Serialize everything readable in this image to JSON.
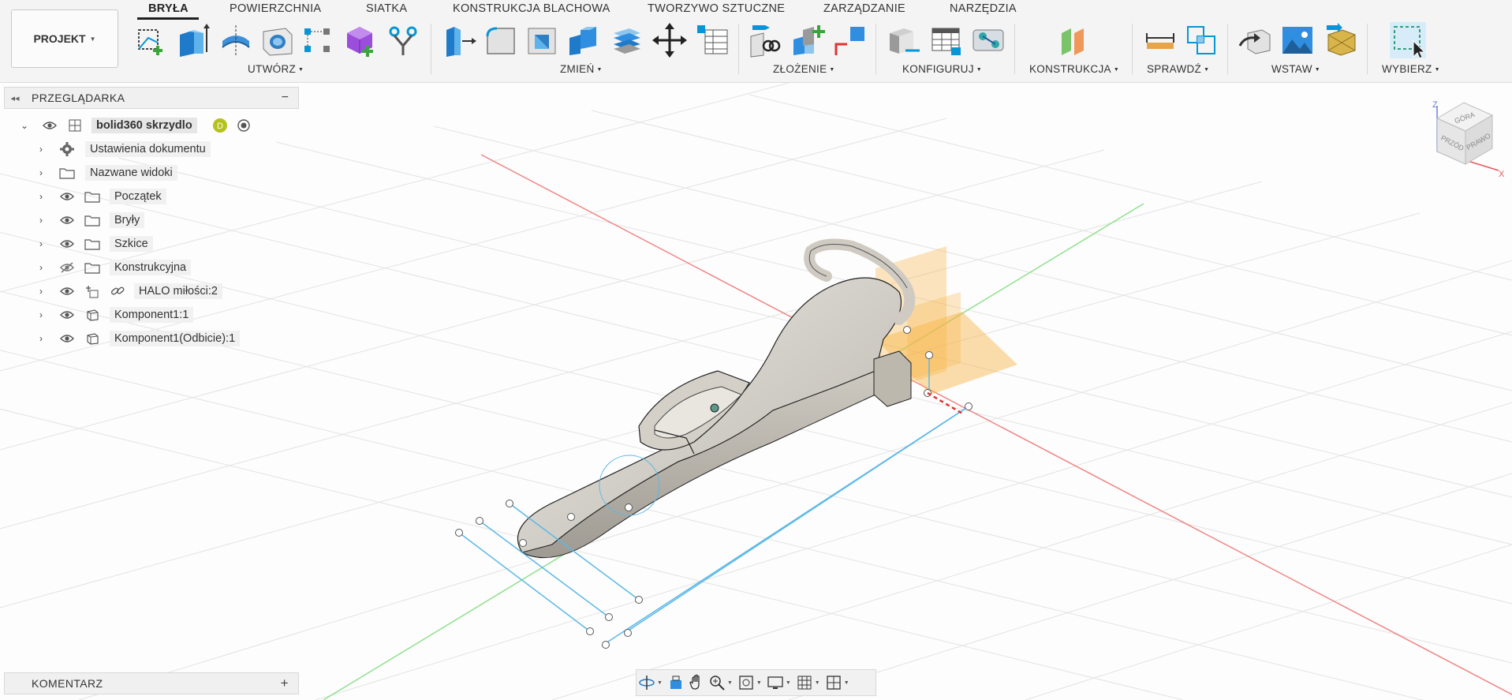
{
  "ribbon": {
    "project_label": "PROJEKT",
    "tabs": [
      "BRYŁA",
      "POWIERZCHNIA",
      "SIATKA",
      "KONSTRUKCJA BLACHOWA",
      "TWORZYWO SZTUCZNE",
      "ZARZĄDZANIE",
      "NARZĘDZIA"
    ],
    "active_tab": "BRYŁA",
    "groups": {
      "create": "UTWÓRZ",
      "modify": "ZMIEŃ",
      "assemble": "ZŁOŻENIE",
      "configure": "KONFIGURUJ",
      "construct": "KONSTRUKCJA",
      "inspect": "SPRAWDŹ",
      "insert": "WSTAW",
      "select": "WYBIERZ"
    }
  },
  "browser": {
    "title": "PRZEGLĄDARKA",
    "root": {
      "label": "bolid360 skrzydlo"
    },
    "items": [
      {
        "label": "Ustawienia dokumentu",
        "icon": "gear-icon"
      },
      {
        "label": "Nazwane widoki",
        "icon": "folder-icon"
      },
      {
        "label": "Początek",
        "icon": "folder-icon"
      },
      {
        "label": "Bryły",
        "icon": "folder-icon"
      },
      {
        "label": "Szkice",
        "icon": "folder-icon"
      },
      {
        "label": "Konstrukcyjna",
        "icon": "folder-icon"
      },
      {
        "label": "HALO miłości:2",
        "icon": "link-icon"
      },
      {
        "label": "Komponent1:1",
        "icon": "component-icon"
      },
      {
        "label": "Komponent1(Odbicie):1",
        "icon": "component-icon"
      }
    ]
  },
  "comments": {
    "title": "KOMENTARZ"
  },
  "viewcube": {
    "top": "GÓRA",
    "front": "PRZÓD",
    "right": "PRAWO",
    "axis_z": "Z",
    "axis_x": "X"
  },
  "colors": {
    "accent": "#0696d7",
    "body": "#d9d6cf",
    "plane": "#f7b445",
    "axis_red": "#e35a5a",
    "axis_green": "#6fd66f"
  }
}
